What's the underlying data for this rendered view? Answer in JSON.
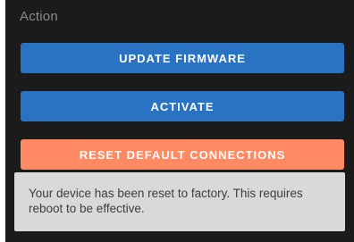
{
  "section": {
    "title": "Action"
  },
  "buttons": {
    "update_firmware": "UPDATE FIRMWARE",
    "activate": "ACTIVATE",
    "reset_default_connections": "RESET DEFAULT CONNECTIONS"
  },
  "toast": {
    "message": "Your device has been reset to factory. This requires reboot to be effective."
  },
  "colors": {
    "panel_background": "#1b1b1b",
    "primary_button": "#2a73c2",
    "warning_button": "#ff8a63",
    "toast_background": "#d9d9d9"
  }
}
